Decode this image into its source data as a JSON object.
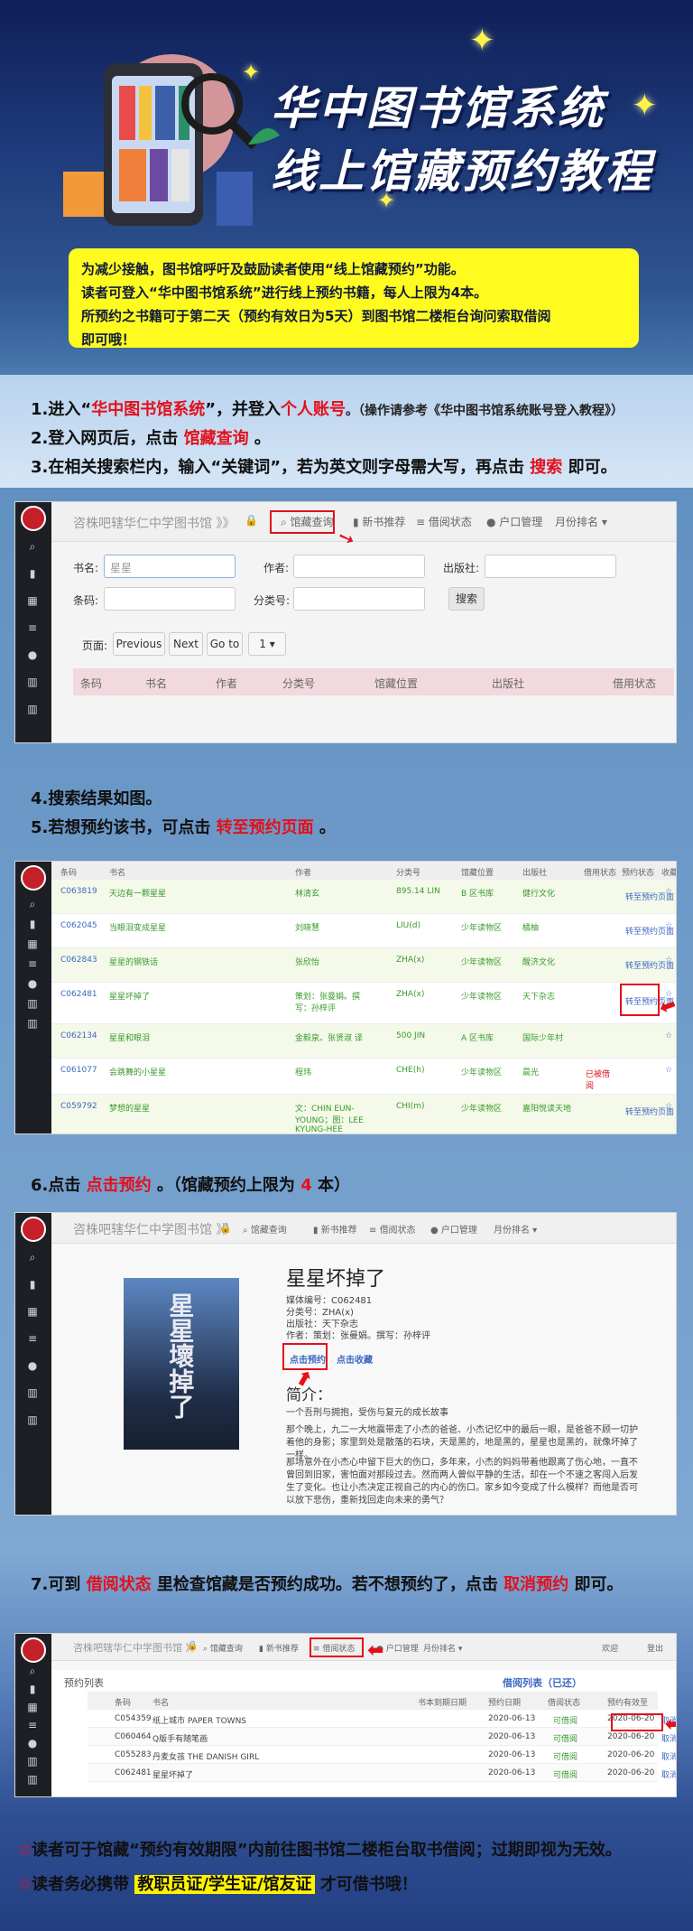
{
  "hero": {
    "title_line1": "华中图书馆系统",
    "title_line2": "线上馆藏预约教程",
    "notice_line1": "为减少接触，图书馆呼吁及鼓励读者使用“线上馆藏预约”功能。",
    "notice_line2": "读者可登入“华中图书馆系统”进行线上预约书籍，每人上限为4本。",
    "notice_line3": "所预约之书籍可于第二天（预约有效日为5天）到图书馆二楼柜台询问索取借阅",
    "notice_line4": "即可哦！"
  },
  "steps": {
    "s1_a": "1.进入“",
    "s1_b": "华中图书馆系统",
    "s1_c": "”，并登入",
    "s1_d": "个人账号",
    "s1_e": "。（操作请参考《华中图书馆系统账号登入教程》）",
    "s2_a": "2.登入网页后，点击 ",
    "s2_b": "馆藏查询",
    "s2_c": " 。",
    "s3_a": "3.在相关搜索栏内，输入“关键词”，若为英文则字母需大写，再点击 ",
    "s3_b": "搜索",
    "s3_c": " 即可。",
    "s4": "4.搜索结果如图。",
    "s5_a": "5.若想预约该书，可点击 ",
    "s5_b": "转至预约页面",
    "s5_c": " 。",
    "s6_a": "6.点击 ",
    "s6_b": "点击预约",
    "s6_c": " 。（馆藏预约上限为 ",
    "s6_d": "4",
    "s6_e": " 本）",
    "s7_a": "7.可到 ",
    "s7_b": "借阅状态",
    "s7_c": " 里检查馆藏是否预约成功。若不想预约了，点击 ",
    "s7_d": "取消预约",
    "s7_e": " 即可。"
  },
  "app": {
    "brand": "咨株吧辖华仁中学图书馆 》》",
    "nav": [
      "馆藏查询",
      "新书推荐",
      "借阅状态",
      "户口管理",
      "月份排名"
    ],
    "brand_sm": "咨株吧辖华仁中学图书馆 》》"
  },
  "search": {
    "label_title": "书名:",
    "label_author": "作者:",
    "label_publisher": "出版社:",
    "label_barcode": "条码:",
    "label_class": "分类号:",
    "title_value": "星星",
    "search_btn": "搜索",
    "page_label": "页面:",
    "prev": "Previous",
    "next": "Next",
    "goto": "Go to",
    "page_num": "1",
    "columns": [
      "条码",
      "书名",
      "作者",
      "分类号",
      "馆藏位置",
      "出版社",
      "借用状态"
    ]
  },
  "results": {
    "columns": [
      "条码",
      "书名",
      "作者",
      "分类号",
      "馆藏位置",
      "出版社",
      "借用状态",
      "预约状态",
      "收藏"
    ],
    "rows": [
      {
        "code": "C063819",
        "title": "天边有一颗星星",
        "author": "林清玄",
        "class": "895.14 LIN",
        "loc": "B 区书库",
        "pub": "健行文化",
        "status": "",
        "reserve": "转至预约页面"
      },
      {
        "code": "C062045",
        "title": "当眼泪变成星星",
        "author": "刘晓慧",
        "class": "LIU(d)",
        "loc": "少年读物区",
        "pub": "橘柚",
        "status": "",
        "reserve": "转至预约页面"
      },
      {
        "code": "C062843",
        "title": "星星的钢铁话",
        "author": "张欣怡",
        "class": "ZHA(x)",
        "loc": "少年读物区",
        "pub": "醒济文化",
        "status": "",
        "reserve": "转至预约页面"
      },
      {
        "code": "C062481",
        "title": "星星坏掉了",
        "author": "策划：张曼娟。撰写：孙梓评",
        "class": "ZHA(x)",
        "loc": "少年读物区",
        "pub": "天下杂志",
        "status": "",
        "reserve": "转至预约页面"
      },
      {
        "code": "C062134",
        "title": "星星和眼泪",
        "author": "金毅泉。张贤淑 译",
        "class": "500 JIN",
        "loc": "A 区书库",
        "pub": "国际少年村",
        "status": "",
        "reserve": ""
      },
      {
        "code": "C061077",
        "title": "会跳舞的小星星",
        "author": "程玮",
        "class": "CHE(h)",
        "loc": "少年读物区",
        "pub": "晨光",
        "status": "已被借阅",
        "reserve": ""
      },
      {
        "code": "C059792",
        "title": "梦想的星星",
        "author": "文：CHIN EUN-YOUNG；图：LEE KYUNG-HEE",
        "class": "CHI(m)",
        "loc": "少年读物区",
        "pub": "嘉阳悦读天地",
        "status": "",
        "reserve": "转至预约页面"
      }
    ]
  },
  "detail": {
    "title": "星星坏掉了",
    "cover_text": "星星壞掉了",
    "media_no": "媒体编号：C062481",
    "class_no": "分类号：ZHA(x)",
    "publisher": "出版社：天下杂志",
    "author": "作者：策划：张曼娟。撰写：孙梓评",
    "reserve_btn": "点击预约",
    "fav_btn": "点击收藏",
    "summary_h": "简介：",
    "summary_sub": "一个吾刑与拥抱，受伤与复元的成长故事",
    "p1": "那个晚上，九二一大地震带走了小杰的爸爸、小杰记忆中的最后一眼，是爸爸不顾一切护着他的身影；家里到处是散落的石块，天是黑的，地是黑的，星星也是黑的，就像坏掉了一样。",
    "p2": "那场意外在小杰心中留下巨大的伤口，多年来，小杰的妈妈带着他跟离了伤心地，一直不曾回到旧家，害怕面对那段过去。然而两人曾似平静的生活，却在一个不速之客闯入后发生了变化。也让小杰决定正视自己的内心的伤口。家乡如今变成了什么模样？而他是否可以放下悲伤，重新找回走向未来的勇气？"
  },
  "borrow": {
    "left_title": "预约列表",
    "right_title": "借阅列表（已还）",
    "user": "欢迎",
    "logout": "登出",
    "columns": [
      "条码",
      "书名",
      "书本到期日期",
      "预约日期",
      "借阅状态",
      "预约有效至"
    ],
    "rows": [
      {
        "code": "C054359",
        "title": "纸上城市 PAPER TOWNS",
        "due": "",
        "date": "2020-06-13",
        "status": "可借阅",
        "valid": "2020-06-20",
        "action": "取消预约"
      },
      {
        "code": "C060464",
        "title": "Q版手有随笔画",
        "due": "",
        "date": "2020-06-13",
        "status": "可借阅",
        "valid": "2020-06-20",
        "action": "取消预约"
      },
      {
        "code": "C055283",
        "title": "丹麦女孩 THE DANISH GIRL",
        "due": "",
        "date": "2020-06-13",
        "status": "可借阅",
        "valid": "2020-06-20",
        "action": "取消预约"
      },
      {
        "code": "C062481",
        "title": "星星坏掉了",
        "due": "",
        "date": "2020-06-13",
        "status": "可借阅",
        "valid": "2020-06-20",
        "action": "取消预约"
      }
    ]
  },
  "footer": {
    "f1": "读者可于馆藏“预约有效期限”内前往图书馆二楼柜台取书借阅；过期即视为无效。",
    "f2_a": "读者务必携带",
    "f2_b": "教职员证/学生证/馆友证",
    "f2_c": "才可借书哦！"
  },
  "colors": {
    "accent_red": "#e3101b",
    "notice_yellow": "#fffb1f",
    "navy": "#1e3a7a"
  }
}
